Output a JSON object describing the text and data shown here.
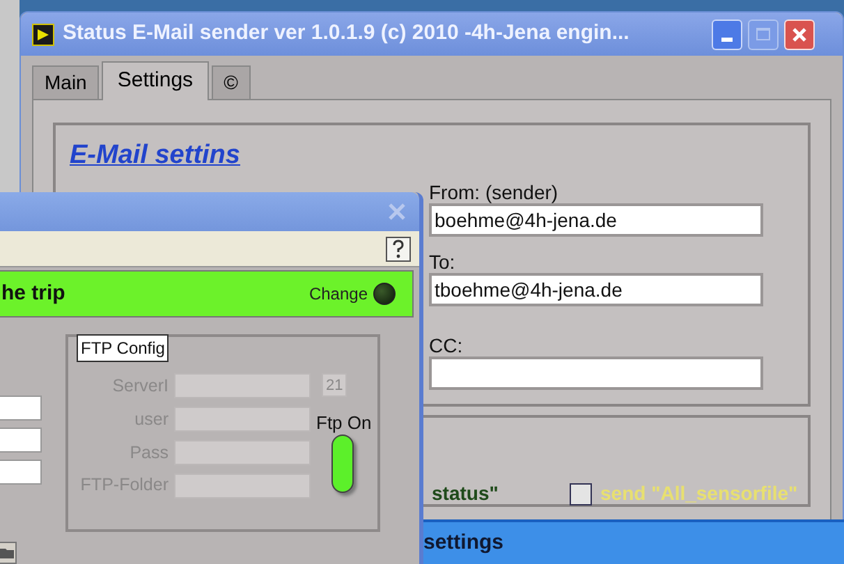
{
  "main_window": {
    "title": "Status E-Mail sender ver 1.0.1.9  (c) 2010 -4h-Jena engin...",
    "tabs": [
      {
        "label": "Main",
        "selected": false
      },
      {
        "label": "Settings",
        "selected": true
      },
      {
        "label": "©",
        "selected": false
      }
    ],
    "email_settings": {
      "heading": "E-Mail settins",
      "fields": [
        {
          "label": "From: (sender)",
          "value": "boehme@4h-jena.de"
        },
        {
          "label": "To:",
          "value": "tboehme@4h-jena.de"
        },
        {
          "label": "CC:"
        }
      ]
    },
    "options": {
      "status_text": "status\"",
      "sensorfile_checkbox": {
        "label": "send \"All_sensorfile\"",
        "checked": false
      }
    },
    "bottom_bar": "settings"
  },
  "config_window": {
    "banner": {
      "text": "he trip",
      "led_label": "Change",
      "led_on": false
    },
    "ftp_config": {
      "title": "FTP Config",
      "port": "21",
      "rows": [
        {
          "label": "ServerI"
        },
        {
          "label": "user"
        },
        {
          "label": "Pass"
        },
        {
          "label": "FTP-Folder"
        }
      ],
      "toggle": {
        "label": "Ftp On",
        "on": true
      }
    }
  }
}
